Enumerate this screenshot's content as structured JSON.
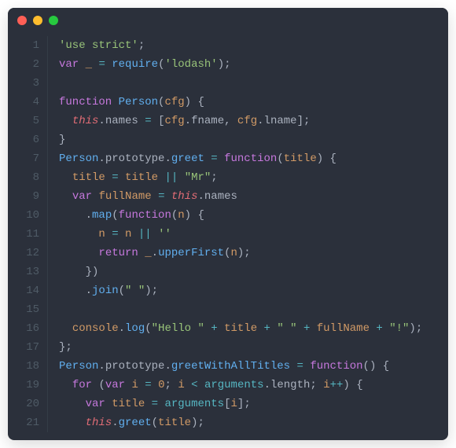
{
  "window": {
    "controls": [
      "close",
      "minimize",
      "zoom"
    ]
  },
  "colors": {
    "background": "#2b303b",
    "gutter": "#4f5b66",
    "keyword": "#c678dd",
    "storage": "#bf616a",
    "function": "#61afef",
    "string": "#98c379",
    "number": "#d19a66",
    "variable": "#d19a66",
    "operator": "#56b6c2",
    "punctuation": "#abb2bf",
    "this": "#e06c75"
  },
  "code": {
    "language": "javascript",
    "lines": [
      {
        "n": 1,
        "t": [
          [
            "str",
            "'use strict'"
          ],
          [
            "pun",
            ";"
          ]
        ]
      },
      {
        "n": 2,
        "t": [
          [
            "kw",
            "var"
          ],
          [
            "pun",
            " "
          ],
          [
            "id",
            "_"
          ],
          [
            "pun",
            " "
          ],
          [
            "op",
            "="
          ],
          [
            "pun",
            " "
          ],
          [
            "fn",
            "require"
          ],
          [
            "par",
            "("
          ],
          [
            "str",
            "'lodash'"
          ],
          [
            "par",
            ")"
          ],
          [
            "pun",
            ";"
          ]
        ]
      },
      {
        "n": 3,
        "t": []
      },
      {
        "n": 4,
        "t": [
          [
            "kw",
            "function"
          ],
          [
            "pun",
            " "
          ],
          [
            "fn",
            "Person"
          ],
          [
            "par",
            "("
          ],
          [
            "id",
            "cfg"
          ],
          [
            "par",
            ")"
          ],
          [
            "pun",
            " "
          ],
          [
            "par",
            "{"
          ]
        ]
      },
      {
        "n": 5,
        "t": [
          [
            "pun",
            "  "
          ],
          [
            "this",
            "this"
          ],
          [
            "pun",
            "."
          ],
          [
            "prop",
            "names"
          ],
          [
            "pun",
            " "
          ],
          [
            "op",
            "="
          ],
          [
            "pun",
            " "
          ],
          [
            "par",
            "["
          ],
          [
            "id",
            "cfg"
          ],
          [
            "pun",
            "."
          ],
          [
            "prop",
            "fname"
          ],
          [
            "pun",
            ","
          ],
          [
            "pun",
            " "
          ],
          [
            "id",
            "cfg"
          ],
          [
            "pun",
            "."
          ],
          [
            "prop",
            "lname"
          ],
          [
            "par",
            "]"
          ],
          [
            "pun",
            ";"
          ]
        ]
      },
      {
        "n": 6,
        "t": [
          [
            "par",
            "}"
          ]
        ]
      },
      {
        "n": 7,
        "t": [
          [
            "fn",
            "Person"
          ],
          [
            "pun",
            "."
          ],
          [
            "prop",
            "prototype"
          ],
          [
            "pun",
            "."
          ],
          [
            "fn",
            "greet"
          ],
          [
            "pun",
            " "
          ],
          [
            "op",
            "="
          ],
          [
            "pun",
            " "
          ],
          [
            "kw",
            "function"
          ],
          [
            "par",
            "("
          ],
          [
            "id",
            "title"
          ],
          [
            "par",
            ")"
          ],
          [
            "pun",
            " "
          ],
          [
            "par",
            "{"
          ]
        ]
      },
      {
        "n": 8,
        "t": [
          [
            "pun",
            "  "
          ],
          [
            "id",
            "title"
          ],
          [
            "pun",
            " "
          ],
          [
            "op",
            "="
          ],
          [
            "pun",
            " "
          ],
          [
            "id",
            "title"
          ],
          [
            "pun",
            " "
          ],
          [
            "op",
            "||"
          ],
          [
            "pun",
            " "
          ],
          [
            "str",
            "\"Mr\""
          ],
          [
            "pun",
            ";"
          ]
        ]
      },
      {
        "n": 9,
        "t": [
          [
            "pun",
            "  "
          ],
          [
            "kw",
            "var"
          ],
          [
            "pun",
            " "
          ],
          [
            "id",
            "fullName"
          ],
          [
            "pun",
            " "
          ],
          [
            "op",
            "="
          ],
          [
            "pun",
            " "
          ],
          [
            "this",
            "this"
          ],
          [
            "pun",
            "."
          ],
          [
            "prop",
            "names"
          ]
        ]
      },
      {
        "n": 10,
        "t": [
          [
            "pun",
            "    "
          ],
          [
            "pun",
            "."
          ],
          [
            "fn",
            "map"
          ],
          [
            "par",
            "("
          ],
          [
            "kw",
            "function"
          ],
          [
            "par",
            "("
          ],
          [
            "id",
            "n"
          ],
          [
            "par",
            ")"
          ],
          [
            "pun",
            " "
          ],
          [
            "par",
            "{"
          ]
        ]
      },
      {
        "n": 11,
        "t": [
          [
            "pun",
            "      "
          ],
          [
            "id",
            "n"
          ],
          [
            "pun",
            " "
          ],
          [
            "op",
            "="
          ],
          [
            "pun",
            " "
          ],
          [
            "id",
            "n"
          ],
          [
            "pun",
            " "
          ],
          [
            "op",
            "||"
          ],
          [
            "pun",
            " "
          ],
          [
            "str",
            "''"
          ]
        ]
      },
      {
        "n": 12,
        "t": [
          [
            "pun",
            "      "
          ],
          [
            "kw",
            "return"
          ],
          [
            "pun",
            " "
          ],
          [
            "id",
            "_"
          ],
          [
            "pun",
            "."
          ],
          [
            "fn",
            "upperFirst"
          ],
          [
            "par",
            "("
          ],
          [
            "id",
            "n"
          ],
          [
            "par",
            ")"
          ],
          [
            "pun",
            ";"
          ]
        ]
      },
      {
        "n": 13,
        "t": [
          [
            "pun",
            "    "
          ],
          [
            "par",
            "}"
          ],
          [
            "par",
            ")"
          ]
        ]
      },
      {
        "n": 14,
        "t": [
          [
            "pun",
            "    "
          ],
          [
            "pun",
            "."
          ],
          [
            "fn",
            "join"
          ],
          [
            "par",
            "("
          ],
          [
            "str",
            "\" \""
          ],
          [
            "par",
            ")"
          ],
          [
            "pun",
            ";"
          ]
        ]
      },
      {
        "n": 15,
        "t": []
      },
      {
        "n": 16,
        "t": [
          [
            "pun",
            "  "
          ],
          [
            "id",
            "console"
          ],
          [
            "pun",
            "."
          ],
          [
            "fn",
            "log"
          ],
          [
            "par",
            "("
          ],
          [
            "str",
            "\"Hello \""
          ],
          [
            "pun",
            " "
          ],
          [
            "op",
            "+"
          ],
          [
            "pun",
            " "
          ],
          [
            "id",
            "title"
          ],
          [
            "pun",
            " "
          ],
          [
            "op",
            "+"
          ],
          [
            "pun",
            " "
          ],
          [
            "str",
            "\" \""
          ],
          [
            "pun",
            " "
          ],
          [
            "op",
            "+"
          ],
          [
            "pun",
            " "
          ],
          [
            "id",
            "fullName"
          ],
          [
            "pun",
            " "
          ],
          [
            "op",
            "+"
          ],
          [
            "pun",
            " "
          ],
          [
            "str",
            "\"!\""
          ],
          [
            "par",
            ")"
          ],
          [
            "pun",
            ";"
          ]
        ]
      },
      {
        "n": 17,
        "t": [
          [
            "par",
            "}"
          ],
          [
            "pun",
            ";"
          ]
        ]
      },
      {
        "n": 18,
        "t": [
          [
            "fn",
            "Person"
          ],
          [
            "pun",
            "."
          ],
          [
            "prop",
            "prototype"
          ],
          [
            "pun",
            "."
          ],
          [
            "fn",
            "greetWithAllTitles"
          ],
          [
            "pun",
            " "
          ],
          [
            "op",
            "="
          ],
          [
            "pun",
            " "
          ],
          [
            "kw",
            "function"
          ],
          [
            "par",
            "("
          ],
          [
            "par",
            ")"
          ],
          [
            "pun",
            " "
          ],
          [
            "par",
            "{"
          ]
        ]
      },
      {
        "n": 19,
        "t": [
          [
            "pun",
            "  "
          ],
          [
            "kw",
            "for"
          ],
          [
            "pun",
            " "
          ],
          [
            "par",
            "("
          ],
          [
            "kw",
            "var"
          ],
          [
            "pun",
            " "
          ],
          [
            "id",
            "i"
          ],
          [
            "pun",
            " "
          ],
          [
            "op",
            "="
          ],
          [
            "pun",
            " "
          ],
          [
            "num",
            "0"
          ],
          [
            "pun",
            "; "
          ],
          [
            "id",
            "i"
          ],
          [
            "pun",
            " "
          ],
          [
            "op",
            "<"
          ],
          [
            "pun",
            " "
          ],
          [
            "cy",
            "arguments"
          ],
          [
            "pun",
            "."
          ],
          [
            "prop",
            "length"
          ],
          [
            "pun",
            "; "
          ],
          [
            "id",
            "i"
          ],
          [
            "op",
            "++"
          ],
          [
            "par",
            ")"
          ],
          [
            "pun",
            " "
          ],
          [
            "par",
            "{"
          ]
        ]
      },
      {
        "n": 20,
        "t": [
          [
            "pun",
            "    "
          ],
          [
            "kw",
            "var"
          ],
          [
            "pun",
            " "
          ],
          [
            "id",
            "title"
          ],
          [
            "pun",
            " "
          ],
          [
            "op",
            "="
          ],
          [
            "pun",
            " "
          ],
          [
            "cy",
            "arguments"
          ],
          [
            "par",
            "["
          ],
          [
            "id",
            "i"
          ],
          [
            "par",
            "]"
          ],
          [
            "pun",
            ";"
          ]
        ]
      },
      {
        "n": 21,
        "t": [
          [
            "pun",
            "    "
          ],
          [
            "this",
            "this"
          ],
          [
            "pun",
            "."
          ],
          [
            "fn",
            "greet"
          ],
          [
            "par",
            "("
          ],
          [
            "id",
            "title"
          ],
          [
            "par",
            ")"
          ],
          [
            "pun",
            ";"
          ]
        ]
      }
    ]
  }
}
